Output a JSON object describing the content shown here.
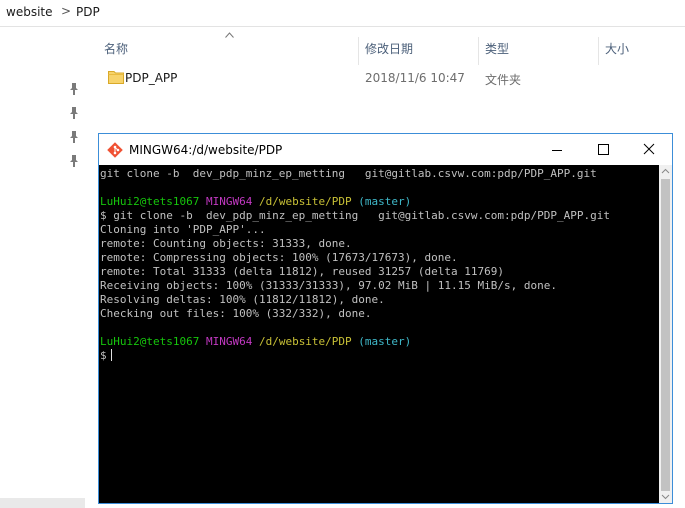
{
  "explorer": {
    "breadcrumb": [
      "website",
      "PDP"
    ],
    "breadcrumb_separator": ">",
    "columns": {
      "name": "名称",
      "modified": "修改日期",
      "type": "类型",
      "size": "大小"
    },
    "files": [
      {
        "name": "PDP_APP",
        "modified": "2018/11/6 10:47",
        "type": "文件夹",
        "icon": "folder-icon"
      }
    ],
    "quick_access_pins": 4
  },
  "terminal": {
    "title": "MINGW64:/d/website/PDP",
    "buttons": {
      "minimize": "minimize-icon",
      "maximize": "maximize-icon",
      "close": "close-icon"
    },
    "lines": [
      {
        "segments": [
          {
            "text": "git clone -b  dev_pdp_minz_ep_metting   git@gitlab.csvw.com:pdp/PDP_APP.git",
            "color": "white"
          }
        ]
      },
      {
        "segments": [
          {
            "text": "",
            "color": "white"
          }
        ]
      },
      {
        "segments": [
          {
            "text": "LuHui2@tets1067 ",
            "color": "green"
          },
          {
            "text": "MINGW64 ",
            "color": "magenta"
          },
          {
            "text": "/d/website/PDP ",
            "color": "yellow"
          },
          {
            "text": "(master)",
            "color": "cyan"
          }
        ]
      },
      {
        "segments": [
          {
            "text": "$ git clone -b  dev_pdp_minz_ep_metting   git@gitlab.csvw.com:pdp/PDP_APP.git",
            "color": "white"
          }
        ]
      },
      {
        "segments": [
          {
            "text": "Cloning into 'PDP_APP'...",
            "color": "white"
          }
        ]
      },
      {
        "segments": [
          {
            "text": "remote: Counting objects: 31333, done.",
            "color": "white"
          }
        ]
      },
      {
        "segments": [
          {
            "text": "remote: Compressing objects: 100% (17673/17673), done.",
            "color": "white"
          }
        ]
      },
      {
        "segments": [
          {
            "text": "remote: Total 31333 (delta 11812), reused 31257 (delta 11769)",
            "color": "white"
          }
        ]
      },
      {
        "segments": [
          {
            "text": "Receiving objects: 100% (31333/31333), 97.02 MiB | 11.15 MiB/s, done.",
            "color": "white"
          }
        ]
      },
      {
        "segments": [
          {
            "text": "Resolving deltas: 100% (11812/11812), done.",
            "color": "white"
          }
        ]
      },
      {
        "segments": [
          {
            "text": "Checking out files: 100% (332/332), done.",
            "color": "white"
          }
        ]
      },
      {
        "segments": [
          {
            "text": "",
            "color": "white"
          }
        ]
      },
      {
        "segments": [
          {
            "text": "LuHui2@tets1067 ",
            "color": "green"
          },
          {
            "text": "MINGW64 ",
            "color": "magenta"
          },
          {
            "text": "/d/website/PDP ",
            "color": "yellow"
          },
          {
            "text": "(master)",
            "color": "cyan"
          }
        ]
      },
      {
        "segments": [
          {
            "text": "$",
            "color": "white"
          }
        ],
        "cursor": true
      }
    ]
  },
  "colors": {
    "terminal_bg": "#000000",
    "green": "#16c60c",
    "magenta": "#c239c2",
    "yellow": "#c8c036",
    "cyan": "#3fb8c9",
    "white": "#c0c0c0",
    "window_border": "#3c8ed8"
  }
}
